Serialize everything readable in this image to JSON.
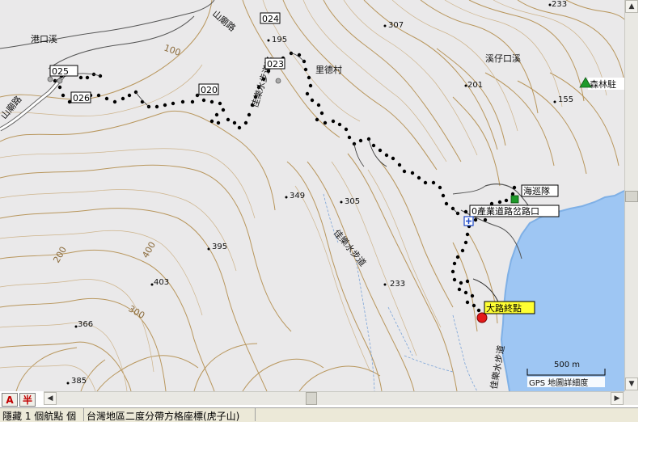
{
  "map": {
    "place_labels": [
      {
        "id": "gangkouxi",
        "text": "港口溪"
      },
      {
        "id": "lidecun",
        "text": "里德村"
      },
      {
        "id": "xizaikouxi",
        "text": "溪仔口溪"
      },
      {
        "id": "senlinxiang",
        "text": "森林駐"
      },
      {
        "id": "shanmiao-road-top",
        "text": "山廟路"
      },
      {
        "id": "shanmiao-road-left",
        "text": "山廟路"
      }
    ],
    "elevations": [
      "195",
      "307",
      "201",
      "155",
      "349",
      "305",
      "395",
      "400",
      "403",
      "233",
      "366",
      "385",
      "233"
    ],
    "contour_labels": [
      "100",
      "200",
      "300"
    ],
    "trail_labels": [
      "佳樂水步道路",
      "佳樂水步道",
      "佳樂水步道"
    ],
    "waypoints": [
      "024",
      "023",
      "025",
      "026",
      "020"
    ],
    "callouts": {
      "haixundui": "海巡隊",
      "trailhead": "0產業道路岔路口",
      "end_point": "大路終點"
    },
    "scale": {
      "label": "500 m",
      "caption": "GPS 地圖詳細度"
    }
  },
  "toolbar": {
    "mode_a": "A",
    "mode_b": "半"
  },
  "status": {
    "waypoint_count": "隱藏 1 個航點 個",
    "grid_system": "台灣地區二度分帶方格座標(虎子山)",
    "blank": ""
  }
}
